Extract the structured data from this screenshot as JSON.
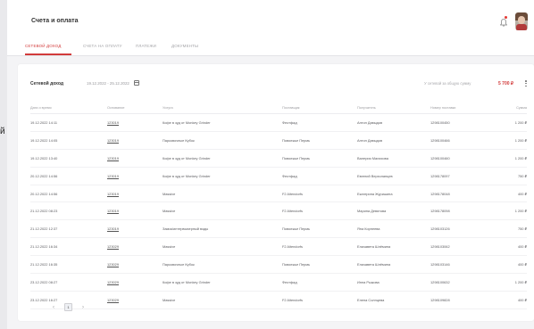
{
  "header": {
    "title": "Счета и оплата",
    "notification_icon": "bell-icon"
  },
  "tabs": [
    {
      "label": "Сетевой доход",
      "active": true
    },
    {
      "label": "Счета на оплату",
      "active": false
    },
    {
      "label": "Платежи",
      "active": false
    },
    {
      "label": "Документы",
      "active": false
    }
  ],
  "colors": {
    "accent": "#d23b3b"
  },
  "card": {
    "title": "Сетевой доход",
    "date_range": "19.12.2022 - 25.12.2022",
    "summary_label": "У сетевой за общую сумму",
    "summary_amount": "5 700 ₽"
  },
  "table": {
    "columns": [
      "Дата и время",
      "Основание",
      "Услуга",
      "Поставщик",
      "Получатель",
      "Номер поставки",
      "Сумма"
    ],
    "rows": [
      [
        "19.12.2022 14:11",
        "123019",
        "Кофе в зуд от Monkey Grinder",
        "Феотфад",
        "Антон Давыдов",
        "1298100450",
        "1 200 ₽"
      ],
      [
        "19.12.2022 14:05",
        "123019",
        "Парковочные Кубок",
        "Поволжье Пермь",
        "Антон Давыдов",
        "1298100466",
        "1 200 ₽"
      ],
      [
        "19.12.2022 13:40",
        "123019",
        "Кофе в зуд от Monkey Grinder",
        "Поволжье Пермь",
        "Валерия Малахова",
        "1298100460",
        "1 200 ₽"
      ],
      [
        "20.12.2022 14:56",
        "123019",
        "Кофе в зуд от Monkey Grinder",
        "Феотфад",
        "Евгений Верхоланцев",
        "1298178097",
        "750 ₽"
      ],
      [
        "20.12.2022 14:56",
        "123019",
        "Massive",
        "F2 Altendorfs",
        "Екатерина Журишина",
        "1298178048",
        "400 ₽"
      ],
      [
        "21.12.2022 08:23",
        "123019",
        "Massive",
        "F2 Altendorfs",
        "Марина Девятова",
        "1298178098",
        "1 200 ₽"
      ],
      [
        "21.12.2022 12:37",
        "123019",
        "Замок/интервьюерный воды",
        "Поволжье Пермь",
        "Яна Корнеева",
        "1298103126",
        "750 ₽"
      ],
      [
        "21.12.2022 16:34",
        "123029",
        "Massive",
        "F2 Altendorfs",
        "Елизавета Шлёмина",
        "1298103062",
        "400 ₽"
      ],
      [
        "21.12.2022 16:35",
        "123029",
        "Парковочные Кубок",
        "Поволжье Пермь",
        "Елизавета Шлёмина",
        "1298103146",
        "400 ₽"
      ],
      [
        "23.12.2022 08:27",
        "123029",
        "Кофе в зуд от Monkey Grinder",
        "Феотфад",
        "Инна Рыжова",
        "1298100632",
        "1 200 ₽"
      ],
      [
        "23.12.2022 16:27",
        "123029",
        "Massive",
        "F2 Altendorfs",
        "Елена Солнцева",
        "1298109828",
        "400 ₽"
      ]
    ]
  },
  "pager": {
    "current_page": "1"
  },
  "side_text": "й"
}
